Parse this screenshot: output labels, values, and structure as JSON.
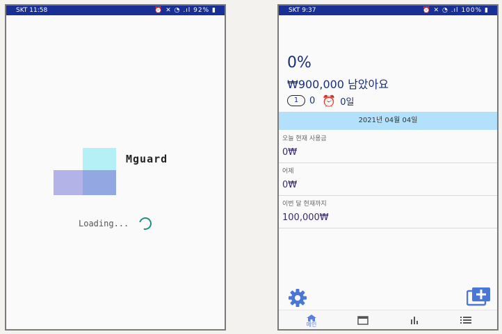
{
  "left_screen": {
    "statusbar": {
      "carrier_time": "SKT 11:58",
      "battery": "92%"
    },
    "brand": "Mguard",
    "loading_text": "Loading..."
  },
  "right_screen": {
    "statusbar": {
      "carrier_time": "SKT 9:37",
      "battery": "100%"
    },
    "percent": "0%",
    "remaining": "₩900,000 남았아요",
    "badge_count_1": "1",
    "badge_value_1": "0",
    "badge_value_2": "0일",
    "date": "2021년 04월 04일",
    "today": {
      "label": "오늘 현재 사용금",
      "value": "0₩"
    },
    "yesterday": {
      "label": "어제",
      "value": "0₩"
    },
    "month": {
      "label": "이번 달 현재까지",
      "value": "100,000₩"
    },
    "nav": {
      "home_label": "메인"
    }
  },
  "colors": {
    "statusbar": "#1a2f93",
    "accent": "#5b7fe0",
    "datebar": "#b3e0fb"
  },
  "icons": [
    "alarm-icon",
    "wifi-icon",
    "battery-icon",
    "gear-icon",
    "add-card-icon",
    "home-icon",
    "calendar-icon",
    "chart-icon",
    "list-icon"
  ]
}
